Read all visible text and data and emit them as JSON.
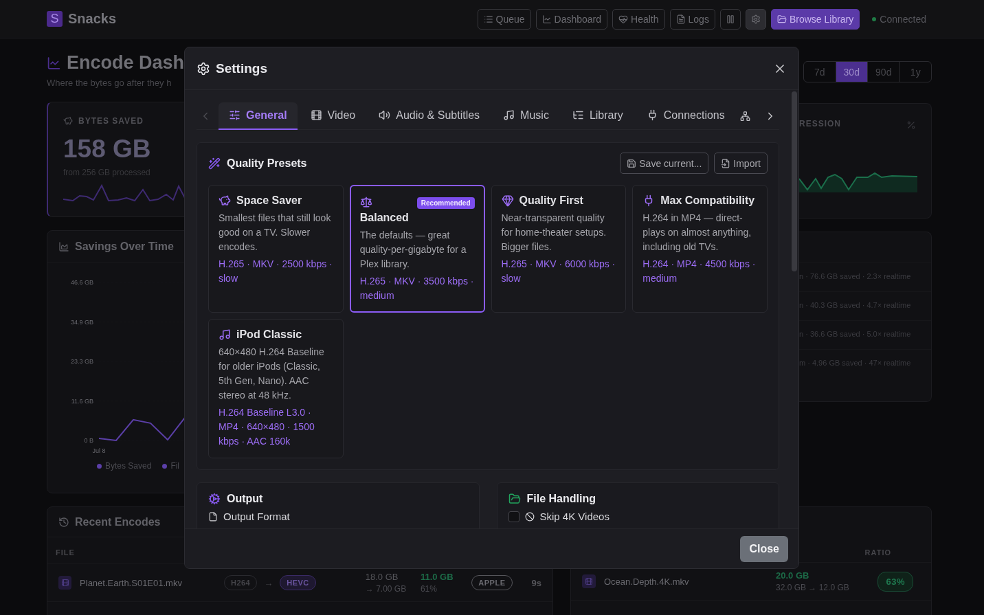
{
  "app": {
    "logo": "S",
    "name": "Snacks"
  },
  "nav": [
    {
      "kind": "outline",
      "label": "Queue",
      "selected": false
    },
    {
      "kind": "outline",
      "label": "Dashboard",
      "selected": false
    },
    {
      "kind": "outline",
      "label": "Health",
      "selected": false
    },
    {
      "kind": "outline",
      "label": "Logs",
      "selected": false
    },
    {
      "kind": "icon",
      "selected": false
    },
    {
      "kind": "icon",
      "selected": true
    },
    {
      "kind": "primary",
      "label": "Browse Library",
      "selected": false
    }
  ],
  "connection": "Connected",
  "dashboard": {
    "title": "Encode Dash",
    "subtitle": "Where the bytes go after they h",
    "periods": [
      {
        "label": "7d",
        "selected": false
      },
      {
        "label": "30d",
        "selected": true
      },
      {
        "label": "90d",
        "selected": false
      },
      {
        "label": "1y",
        "selected": false
      }
    ],
    "bytes_saved": {
      "label": "BYTES SAVED",
      "value": "158 GB",
      "note": "from 256 GB processed"
    },
    "compression": {
      "label": "RESSION"
    },
    "savings": {
      "title": "Savings Over Time",
      "chart_data": {
        "type": "line",
        "ylim": [
          0,
          46.6
        ],
        "yticks": [
          {
            "value": 46.6,
            "label": "46.6 GB"
          },
          {
            "value": 34.9,
            "label": "34.9 GB"
          },
          {
            "value": 23.3,
            "label": "23.3 GB"
          },
          {
            "value": 11.6,
            "label": "11.6 GB"
          },
          {
            "value": 0,
            "label": "0 B"
          }
        ],
        "series": [
          {
            "name": "Bytes Saved",
            "color": "#5b3fa8",
            "values": [
              0.6,
              0,
              6.1,
              5.1,
              0.2,
              6.7
            ]
          }
        ]
      },
      "date_label": "Jul 8",
      "more_legend": [
        "Fil"
      ]
    },
    "activity": [
      "n · 76.6 GB saved · 2.3× realtime",
      "n · 40.3 GB saved · 4.7× realtime",
      "n · 36.6 GB saved · 5.0× realtime",
      "m · 4.96 GB saved · 47× realtime"
    ],
    "recent": {
      "title": "Recent Encodes",
      "left_column": "FILE",
      "right_column": "RATIO",
      "left_row": {
        "file": "Planet.Earth.S01E01.mkv",
        "from_codec": "H264",
        "arrow": "→",
        "to_codec": "HEVC",
        "size": "18.0 GB",
        "new_size": "→ 7.00 GB",
        "saved": "11.0 GB",
        "saved_pct": "61%",
        "device": "APPLE",
        "time": "9s"
      },
      "right_row": {
        "file": "Ocean.Depth.4K.mkv",
        "saved": "20.0 GB",
        "sizes": "32.0 GB → 12.0 GB",
        "ratio": "63%"
      }
    }
  },
  "settings": {
    "title": "Settings",
    "tabs": [
      {
        "label": "General",
        "selected": true
      },
      {
        "label": "Video",
        "selected": false
      },
      {
        "label": "Audio & Subtitles",
        "selected": false
      },
      {
        "label": "Music",
        "selected": false
      },
      {
        "label": "Library",
        "selected": false
      },
      {
        "label": "Connections",
        "selected": false
      }
    ],
    "presets": {
      "title": "Quality Presets",
      "buttons": [
        "Save current...",
        "Import"
      ],
      "items": [
        {
          "name": "Space Saver",
          "description": "Smallest files that still look good on a TV. Slower encodes.",
          "specs": "H.265 · MKV · 2500 kbps · slow",
          "selected": false
        },
        {
          "name": "Balanced",
          "badge": "Recommended",
          "description": "The defaults — great quality-per-gigabyte for a Plex library.",
          "specs": "H.265 · MKV · 3500 kbps · medium",
          "selected": true
        },
        {
          "name": "Quality First",
          "description": "Near-transparent quality for home-theater setups. Bigger files.",
          "specs": "H.265 · MKV · 6000 kbps · slow",
          "selected": false
        },
        {
          "name": "Max Compatibility",
          "description": "H.264 in MP4 — direct-plays on almost anything, including old TVs.",
          "specs": "H.264 · MP4 · 4500 kbps · medium",
          "selected": false
        },
        {
          "name": "iPod Classic",
          "description": "640×480 H.264 Baseline for older iPods (Classic, 5th Gen, Nano). AAC stereo at 48 kHz.",
          "specs": "H.264 Baseline L3.0 · MP4 · 640×480 · 1500 kbps · AAC 160k",
          "selected": false
        }
      ]
    },
    "output": {
      "title": "Output",
      "item": "Output Format"
    },
    "file_handling": {
      "title": "File Handling",
      "item": "Skip 4K Videos",
      "checked": false
    },
    "close": "Close"
  }
}
